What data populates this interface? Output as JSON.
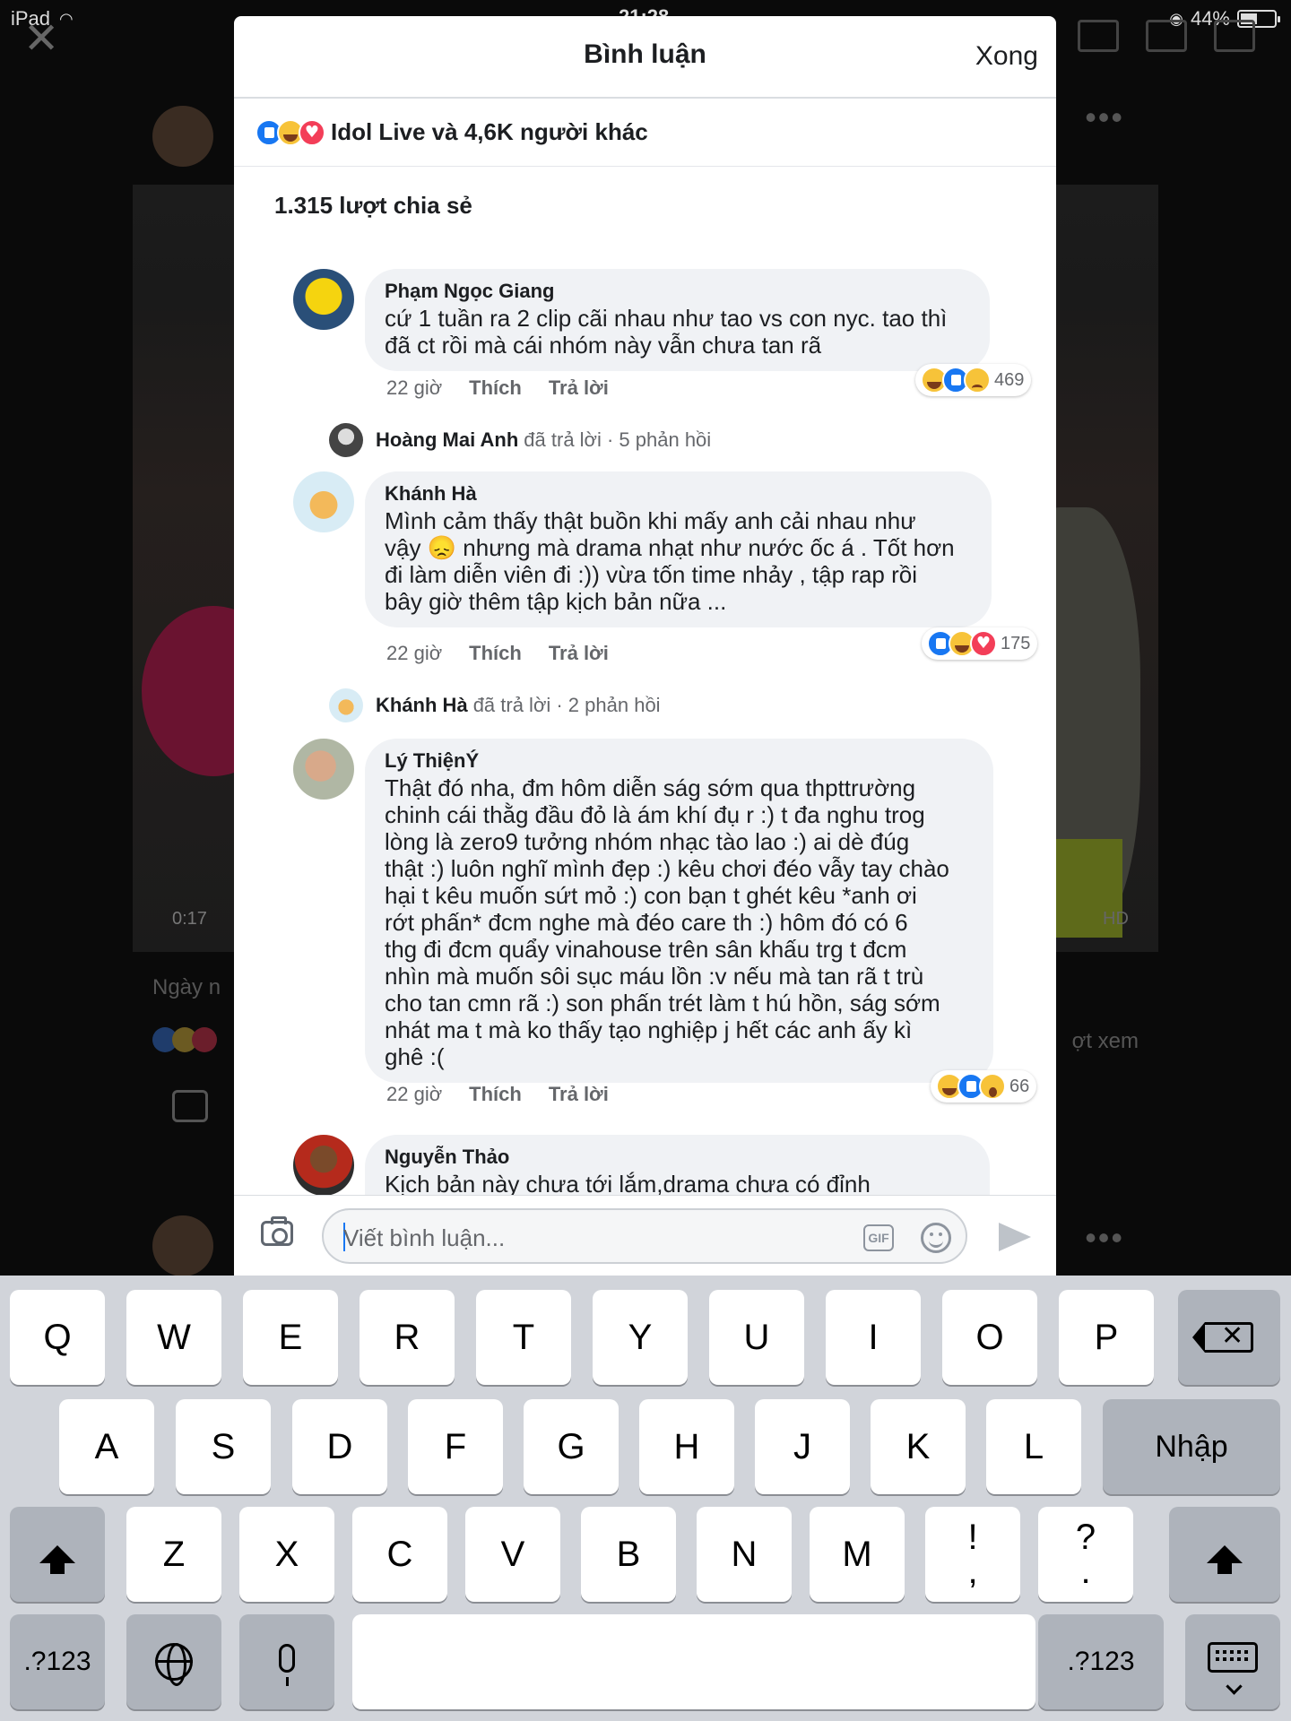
{
  "status_bar": {
    "device": "iPad",
    "time": "21:28",
    "battery": "44%",
    "battery_level": 0.44
  },
  "background": {
    "video_time": "0:17",
    "quality": "HD",
    "caption": "Ngày n",
    "views": "ợt xem"
  },
  "modal": {
    "title": "Bình luận",
    "done_label": "Xong",
    "likes_summary": "Idol Live và 4,6K người khác",
    "shares": "1.315 lượt chia sẻ"
  },
  "comments": [
    {
      "name": "Phạm Ngọc Giang",
      "text": "cứ 1 tuần ra 2 clip cãi nhau như tao vs con nyc. tao thì\nđã ct rồi mà cái nhóm này vẫn chưa tan rã",
      "time": "22 giờ",
      "like_label": "Thích",
      "reply_label": "Trả lời",
      "reactions": [
        "haha",
        "like",
        "sad"
      ],
      "reaction_count": "469",
      "reply": {
        "name": "Hoàng Mai Anh",
        "action": "đã trả lời · 5 phản hồi"
      }
    },
    {
      "name": "Khánh Hà",
      "text": "Mình cảm thấy thật buồn khi mấy anh cải nhau như\nvậy 😞 nhưng mà drama nhạt như nước ốc á . Tốt hơn\nđi làm diễn viên đi :)) vừa tốn time nhảy , tập rap rồi\nbây giờ thêm tập kịch bản nữa ...",
      "time": "22 giờ",
      "like_label": "Thích",
      "reply_label": "Trả lời",
      "reactions": [
        "like",
        "haha",
        "love"
      ],
      "reaction_count": "175",
      "reply": {
        "name": "Khánh Hà",
        "action": "đã trả lời · 2 phản hồi"
      }
    },
    {
      "name": "Lý ThiệnÝ",
      "text": "Thật đó nha, đm hôm diễn ság sớm qua thpttrường\nchinh cái thằg đầu đỏ là ám khí đụ r :) t đa nghu trog\nlòng là zero9 tưởng nhóm nhạc tào lao :) ai dè đúg\nthật :) luôn nghĩ mình đẹp :) kêu chơi đéo vẫy tay chào\nhại t kêu muốn sứt mỏ :) con bạn t ghét kêu *anh ơi\nrớt phấn* đcm nghe mà đéo care th  :) hôm đó có 6\nthg đi đcm quẩy vinahouse trên sân khấu trg t đcm\nnhìn mà muốn sôi sục máu lồn :v nếu mà tan rã t trù\ncho tan cmn rã :) son phấn trét làm t hú hồn, ság sớm\nnhát ma t mà ko thấy tạo nghiệp j hết các anh ấy kì\nghê :(",
      "time": "22 giờ",
      "like_label": "Thích",
      "reply_label": "Trả lời",
      "reactions": [
        "haha",
        "like",
        "wow"
      ],
      "reaction_count": "66"
    },
    {
      "name": "Nguyễn Thảo",
      "text": "Kịch bản này chưa tới lắm,drama chưa có đỉnh\nđiểm cao trào chưa có.Lời thoại khá nhàm.Cách diễn"
    }
  ],
  "composer": {
    "placeholder": "Viết bình luận...",
    "gif_label": "GIF"
  },
  "keyboard": {
    "row1": [
      "Q",
      "W",
      "E",
      "R",
      "T",
      "Y",
      "U",
      "I",
      "O",
      "P"
    ],
    "row2": [
      "A",
      "S",
      "D",
      "F",
      "G",
      "H",
      "J",
      "K",
      "L"
    ],
    "enter": "Nhập",
    "row3": [
      "Z",
      "X",
      "C",
      "V",
      "B",
      "N",
      "M"
    ],
    "punct1": [
      "!",
      ","
    ],
    "punct2": [
      "?",
      "."
    ],
    "numbers": ".?123"
  },
  "colors": {
    "accent": "#1877f2",
    "like": "#1877f2",
    "love": "#f33e58",
    "haha": "#f7c339",
    "keyboard_bg": "#d1d4da"
  }
}
